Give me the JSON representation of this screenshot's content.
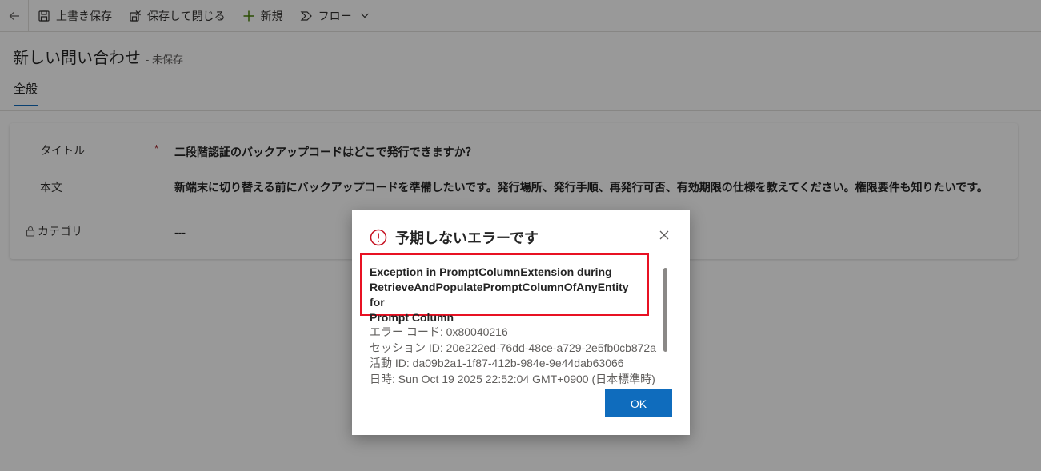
{
  "toolbar": {
    "save": "上書き保存",
    "save_close": "保存して閉じる",
    "new": "新規",
    "flow": "フロー"
  },
  "header": {
    "title": "新しい問い合わせ",
    "subtitle": "- 未保存",
    "tab": "全般"
  },
  "form": {
    "title_label": "タイトル",
    "required_mark": "*",
    "title_value": "二段階認証のバックアップコードはどこで発行できますか？",
    "body_label": "本文",
    "body_value": "新端末に切り替える前にバックアップコードを準備したいです。発行場所、発行手順、再発行可否、有効期限の仕様を教えてください。権限要件も知りたいです。",
    "category_label": "カテゴリ",
    "category_value": "---"
  },
  "dialog": {
    "title": "予期しないエラーです",
    "message_lines": [
      "Exception in PromptColumnExtension during",
      "RetrieveAndPopulatePromptColumnOfAnyEntity for",
      "Prompt Column"
    ],
    "details": [
      "エラー コード: 0x80040216",
      "セッション ID: 20e222ed-76dd-48ce-a729-2e5fb0cb872a",
      "活動 ID: da09b2a1-1f87-412b-984e-9e44dab63066",
      "日時: Sun Oct 19 2025 22:52:04 GMT+0900 (日本標準時)"
    ],
    "ok": "OK"
  },
  "colors": {
    "accent": "#0f6cbd",
    "error_red": "#c50f1f",
    "highlight_border": "#e81123"
  },
  "icons": [
    "back-arrow-icon",
    "save-icon",
    "save-close-icon",
    "plus-icon",
    "flow-icon",
    "chevron-down-icon",
    "lock-icon",
    "error-icon",
    "close-icon"
  ]
}
